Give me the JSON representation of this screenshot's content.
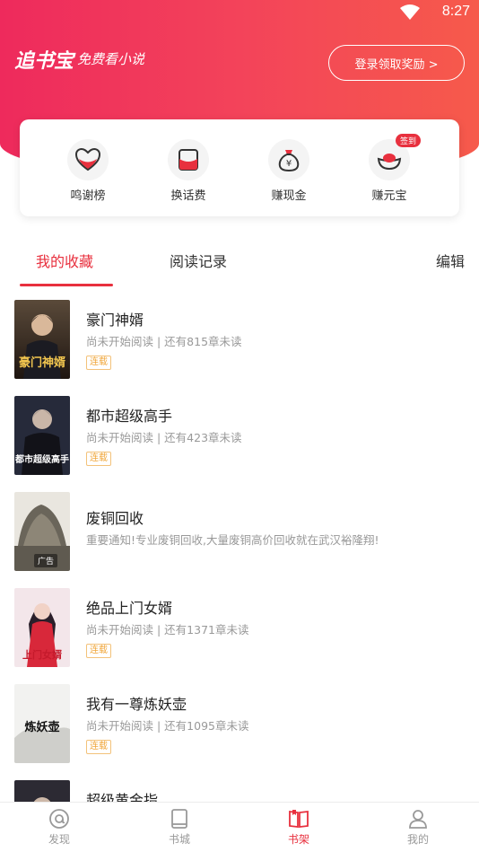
{
  "status": {
    "time": "8:27"
  },
  "header": {
    "logo": "追书宝",
    "slogan": "免费看小说",
    "login_button": "登录领取奖励 >"
  },
  "quick_actions": [
    {
      "label": "鸣谢榜",
      "icon": "heart-cup-icon"
    },
    {
      "label": "换话费",
      "icon": "wallet-icon"
    },
    {
      "label": "赚现金",
      "icon": "money-bag-icon"
    },
    {
      "label": "赚元宝",
      "icon": "ingot-icon",
      "badge": "签到"
    }
  ],
  "tabs": {
    "favorites": "我的收藏",
    "history": "阅读记录",
    "edit": "编辑"
  },
  "books": [
    {
      "title": "豪门神婿",
      "sub": "尚未开始阅读 | 还有815章未读",
      "tag": "连载",
      "cover_text": "豪门神婿"
    },
    {
      "title": "都市超级高手",
      "sub": "尚未开始阅读 | 还有423章未读",
      "tag": "连载",
      "cover_text": "都市超级高手"
    },
    {
      "title": "废铜回收",
      "sub": "重要通知!专业废铜回收,大量废铜高价回收就在武汉裕隆翔!",
      "ad_label": "广告"
    },
    {
      "title": "绝品上门女婿",
      "sub": "尚未开始阅读 | 还有1371章未读",
      "tag": "连载",
      "cover_text": "上门女婿"
    },
    {
      "title": "我有一尊炼妖壶",
      "sub": "尚未开始阅读 | 还有1095章未读",
      "tag": "连载",
      "cover_text": "炼妖壶"
    },
    {
      "title": "超级黄金指",
      "sub": "",
      "tag": "",
      "cover_text": ""
    }
  ],
  "bottom_nav": [
    {
      "label": "发现",
      "icon": "discover-icon"
    },
    {
      "label": "书城",
      "icon": "bookstore-icon"
    },
    {
      "label": "书架",
      "icon": "bookshelf-icon",
      "active": true
    },
    {
      "label": "我的",
      "icon": "profile-icon"
    }
  ],
  "colors": {
    "brand": "#ee2a5c",
    "accent": "#e8303e",
    "tag": "#f0a63a"
  }
}
